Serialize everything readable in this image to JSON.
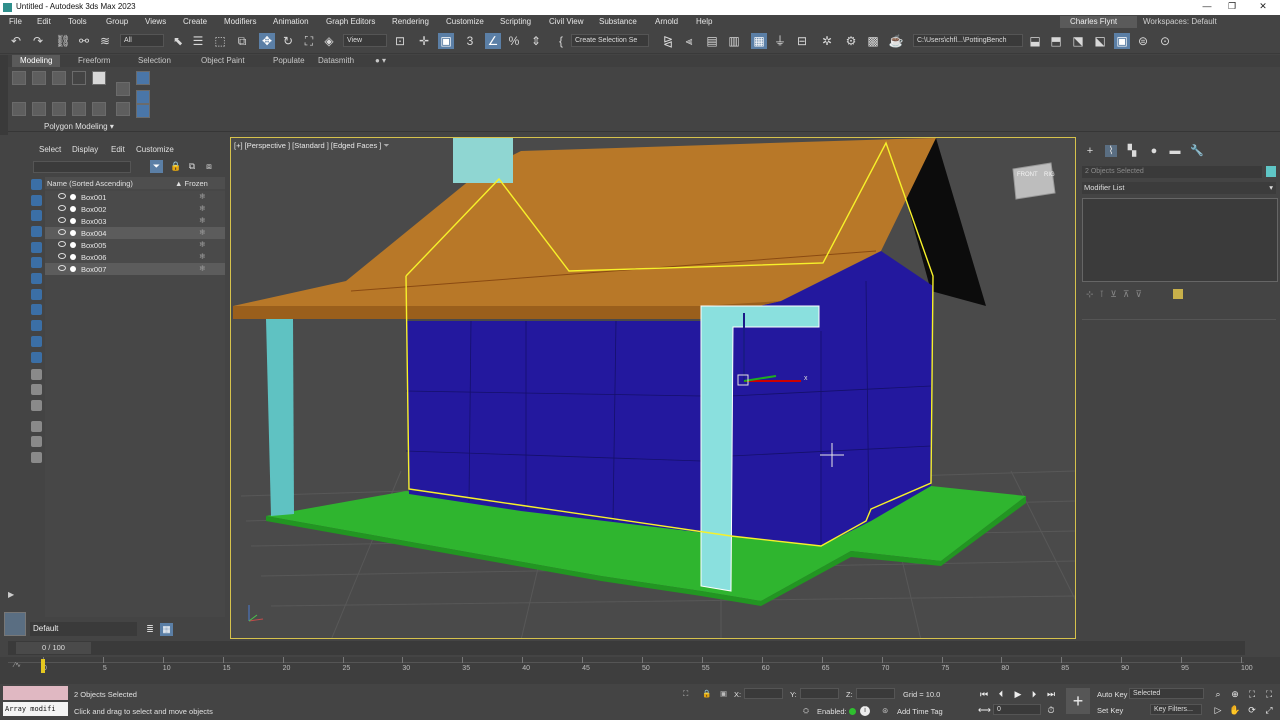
{
  "window": {
    "title": "Untitled - Autodesk 3ds Max 2023",
    "minimize": "—",
    "maximize": "❐",
    "close": "✕"
  },
  "menu": [
    "File",
    "Edit",
    "Tools",
    "Group",
    "Views",
    "Create",
    "Modifiers",
    "Animation",
    "Graph Editors",
    "Rendering",
    "Customize",
    "Scripting",
    "Civil View",
    "Substance",
    "Arnold",
    "Help"
  ],
  "user": "Charles Flynt",
  "workspace": {
    "label": "Workspaces:",
    "value": "Default"
  },
  "toolbar": {
    "filter": "All",
    "refcoord": "View",
    "selection_set": "Create Selection Se",
    "path": "C:\\Users\\chfl...\\PottingBench"
  },
  "ribbon": {
    "tabs": [
      "Modeling",
      "Freeform",
      "Selection",
      "Object Paint",
      "Populate",
      "Datasmith"
    ],
    "active": "Modeling",
    "panel": "Polygon Modeling"
  },
  "scene_explorer": {
    "tabs": [
      "Select",
      "Display",
      "Edit",
      "Customize"
    ],
    "header_name": "Name (Sorted Ascending)",
    "header_frozen": "▲ Frozen",
    "rows": [
      {
        "name": "Box001",
        "selected": false
      },
      {
        "name": "Box002",
        "selected": false
      },
      {
        "name": "Box003",
        "selected": false
      },
      {
        "name": "Box004",
        "selected": true
      },
      {
        "name": "Box005",
        "selected": false
      },
      {
        "name": "Box006",
        "selected": false
      },
      {
        "name": "Box007",
        "selected": true
      }
    ],
    "layer": "Default"
  },
  "viewport": {
    "label": "[+] [Perspective ] [Standard ] [Edged Faces ]",
    "viewcube_left": "FRONT",
    "viewcube_right": "RIG",
    "gizmo_x": "x"
  },
  "command_panel": {
    "name_field": "2 Objects Selected",
    "modifier_list": "Modifier List",
    "color": "#5fc6c6"
  },
  "time": {
    "slider": "0 / 100",
    "ticks": [
      0,
      5,
      10,
      15,
      20,
      25,
      30,
      35,
      40,
      45,
      50,
      55,
      60,
      65,
      70,
      75,
      80,
      85,
      90,
      95,
      100
    ]
  },
  "status": {
    "listener_input": "Array modifi",
    "selected": "2 Objects Selected",
    "prompt": "Click and drag to select and move objects",
    "x_label": "X:",
    "y_label": "Y:",
    "z_label": "Z:",
    "grid": "Grid = 10.0",
    "enabled": "Enabled:",
    "add_time_tag": "Add Time Tag",
    "auto_key": "Auto Key",
    "set_key": "Set Key",
    "selected_drop": "Selected",
    "key_filters": "Key Filters...",
    "frame": "0"
  }
}
